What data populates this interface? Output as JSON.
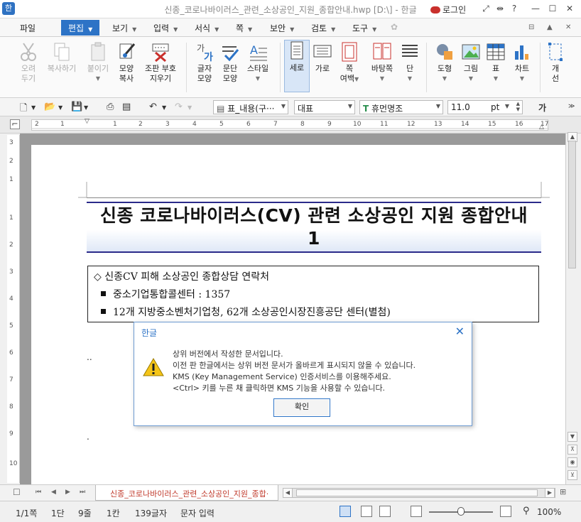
{
  "window": {
    "title": "신종_코로나바이러스_관련_소상공인_지원_종합안내.hwp [D:\\] - 한글",
    "app_logo": "한",
    "login_label": "로그인",
    "help_label": "?"
  },
  "menu": {
    "items": [
      "파일",
      "편집",
      "보기",
      "입력",
      "서식",
      "쪽",
      "보안",
      "검토",
      "도구"
    ],
    "active": "편집"
  },
  "ribbon": {
    "buttons": [
      {
        "l1": "오려",
        "l2": "두기",
        "disabled": true
      },
      {
        "l1": "복사하기",
        "l2": "",
        "disabled": true
      },
      {
        "l1": "붙이기",
        "l2": "",
        "disabled": true
      },
      {
        "l1": "모양",
        "l2": "복사",
        "disabled": false
      },
      {
        "l1": "조판 부호",
        "l2": "지우기",
        "disabled": false
      },
      {
        "l1": "글자",
        "l2": "모양",
        "disabled": false
      },
      {
        "l1": "문단",
        "l2": "모양",
        "disabled": false
      },
      {
        "l1": "스타일",
        "l2": "",
        "disabled": false
      },
      {
        "l1": "세로",
        "l2": "",
        "disabled": false
      },
      {
        "l1": "가로",
        "l2": "",
        "disabled": false
      },
      {
        "l1": "쪽",
        "l2": "여백",
        "disabled": false
      },
      {
        "l1": "바탕쪽",
        "l2": "",
        "disabled": false
      },
      {
        "l1": "단",
        "l2": "",
        "disabled": false
      },
      {
        "l1": "도형",
        "l2": "",
        "disabled": false
      },
      {
        "l1": "그림",
        "l2": "",
        "disabled": false
      },
      {
        "l1": "표",
        "l2": "",
        "disabled": false
      },
      {
        "l1": "차트",
        "l2": "",
        "disabled": false
      },
      {
        "l1": "개",
        "l2": "선",
        "disabled": false
      }
    ]
  },
  "toolbar": {
    "style_combo": "표_내용(구···",
    "lang_combo": "대표",
    "font_combo": "휴먼명조",
    "font_icon": "T",
    "size_value": "11.0",
    "size_unit": "pt",
    "bold_label": "가"
  },
  "ruler": {
    "numbers": [
      "2",
      "1",
      "1",
      "2",
      "3",
      "4",
      "5",
      "6",
      "7",
      "8",
      "9",
      "10",
      "11",
      "12",
      "13",
      "14",
      "15",
      "16",
      "17"
    ],
    "vertical_numbers": [
      "3",
      "2",
      "1",
      "1",
      "2",
      "3",
      "4",
      "5",
      "6",
      "7",
      "8",
      "9",
      "10"
    ]
  },
  "document": {
    "title_line1": "신종 코로나바이러스(CV) 관련 소상공인 지원 종합안내",
    "title_line2": "1",
    "section_heading": "◇ 신종CV 피해 소상공인 종합상담 연락처",
    "bullets": [
      "중소기업통합콜센터 : 1357",
      "12개 지방중소벤처기업청, 62개 소상공인시장진흥공단 센터(별첨)"
    ],
    "stray_mark_1": "..",
    "stray_mark_2": "."
  },
  "dialog": {
    "title": "한글",
    "close_label": "✕",
    "messages": [
      "상위 버전에서 작성한 문서입니다.",
      "이전 판 한글에서는 상위 버전 문서가 올바르게 표시되지 않을 수 있습니다.",
      "KMS (Key Management Service) 인증서비스를 이용해주세요.",
      "<Ctrl> 키를 누른 채 클릭하면 KMS 기능을 사용할 수 있습니다."
    ],
    "ok_label": "확인"
  },
  "tabs": {
    "doc_tab": "신종_코로나바이러스_관련_소상공인_지원_종합·"
  },
  "status": {
    "page": "1/1쪽",
    "column": "1단",
    "line": "9줄",
    "col": "1칸",
    "chars": "139글자",
    "mode": "문자 입력",
    "zoom": "100%"
  },
  "colors": {
    "accent": "#2d73c6",
    "title_rule": "#2b2b8a",
    "tab_text": "#c0392b"
  }
}
